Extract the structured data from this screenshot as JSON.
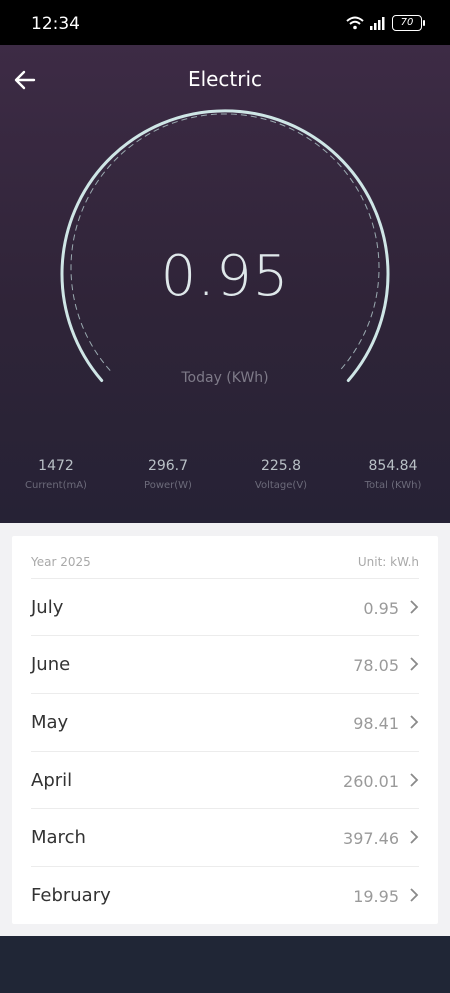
{
  "status_bar": {
    "time": "12:34",
    "battery": "70"
  },
  "header": {
    "title": "Electric"
  },
  "gauge": {
    "value": "0.95",
    "label": "Today (KWh)"
  },
  "stats": [
    {
      "value": "1472",
      "label": "Current(mA)"
    },
    {
      "value": "296.7",
      "label": "Power(W)"
    },
    {
      "value": "225.8",
      "label": "Voltage(V)"
    },
    {
      "value": "854.84",
      "label": "Total (KWh)"
    }
  ],
  "history": {
    "year_label": "Year 2025",
    "unit_label": "Unit: kW.h",
    "rows": [
      {
        "month": "July",
        "value": "0.95"
      },
      {
        "month": "June",
        "value": "78.05"
      },
      {
        "month": "May",
        "value": "98.41"
      },
      {
        "month": "April",
        "value": "260.01"
      },
      {
        "month": "March",
        "value": "397.46"
      },
      {
        "month": "February",
        "value": "19.95"
      }
    ]
  },
  "colors": {
    "hero_top": "#3d2b45",
    "hero_bottom": "#262235",
    "gauge_stroke": "#cfe6e6",
    "bottom_bar": "#202636"
  }
}
